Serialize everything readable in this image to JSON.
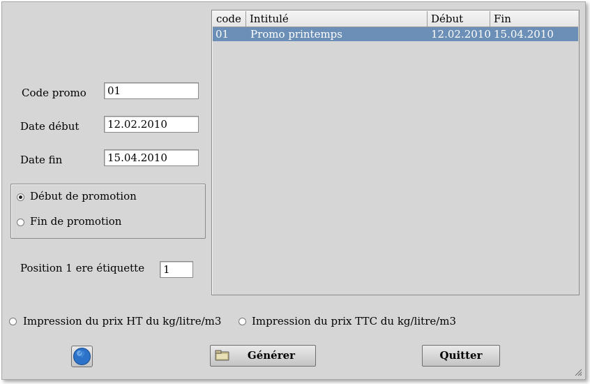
{
  "form": {
    "code_label": "Code promo",
    "code_value": "01",
    "start_label": "Date début",
    "start_value": "12.02.2010",
    "end_label": "Date fin",
    "end_value": "15.04.2010",
    "radio_start_label": "Début de promotion",
    "radio_end_label": "Fin de promotion",
    "radio_selected": "start",
    "position_label": "Position 1 ere étiquette",
    "position_value": "1"
  },
  "table": {
    "columns": [
      "code",
      "Intitulé",
      "Début",
      "Fin"
    ],
    "rows": [
      {
        "code": "01",
        "title": "Promo printemps",
        "start": "12.02.2010",
        "end": "15.04.2010",
        "selected": true
      }
    ]
  },
  "print_options": {
    "ht_label": "Impression du prix HT du kg/litre/m3",
    "ttc_label": "Impression du prix TTC du kg/litre/m3"
  },
  "buttons": {
    "help_icon": "help-icon",
    "generate_label": "Générer",
    "generate_icon": "folder-icon",
    "quit_label": "Quitter"
  },
  "colors": {
    "window_bg": "#d6d6d6",
    "selection": "#6b8fb7"
  }
}
